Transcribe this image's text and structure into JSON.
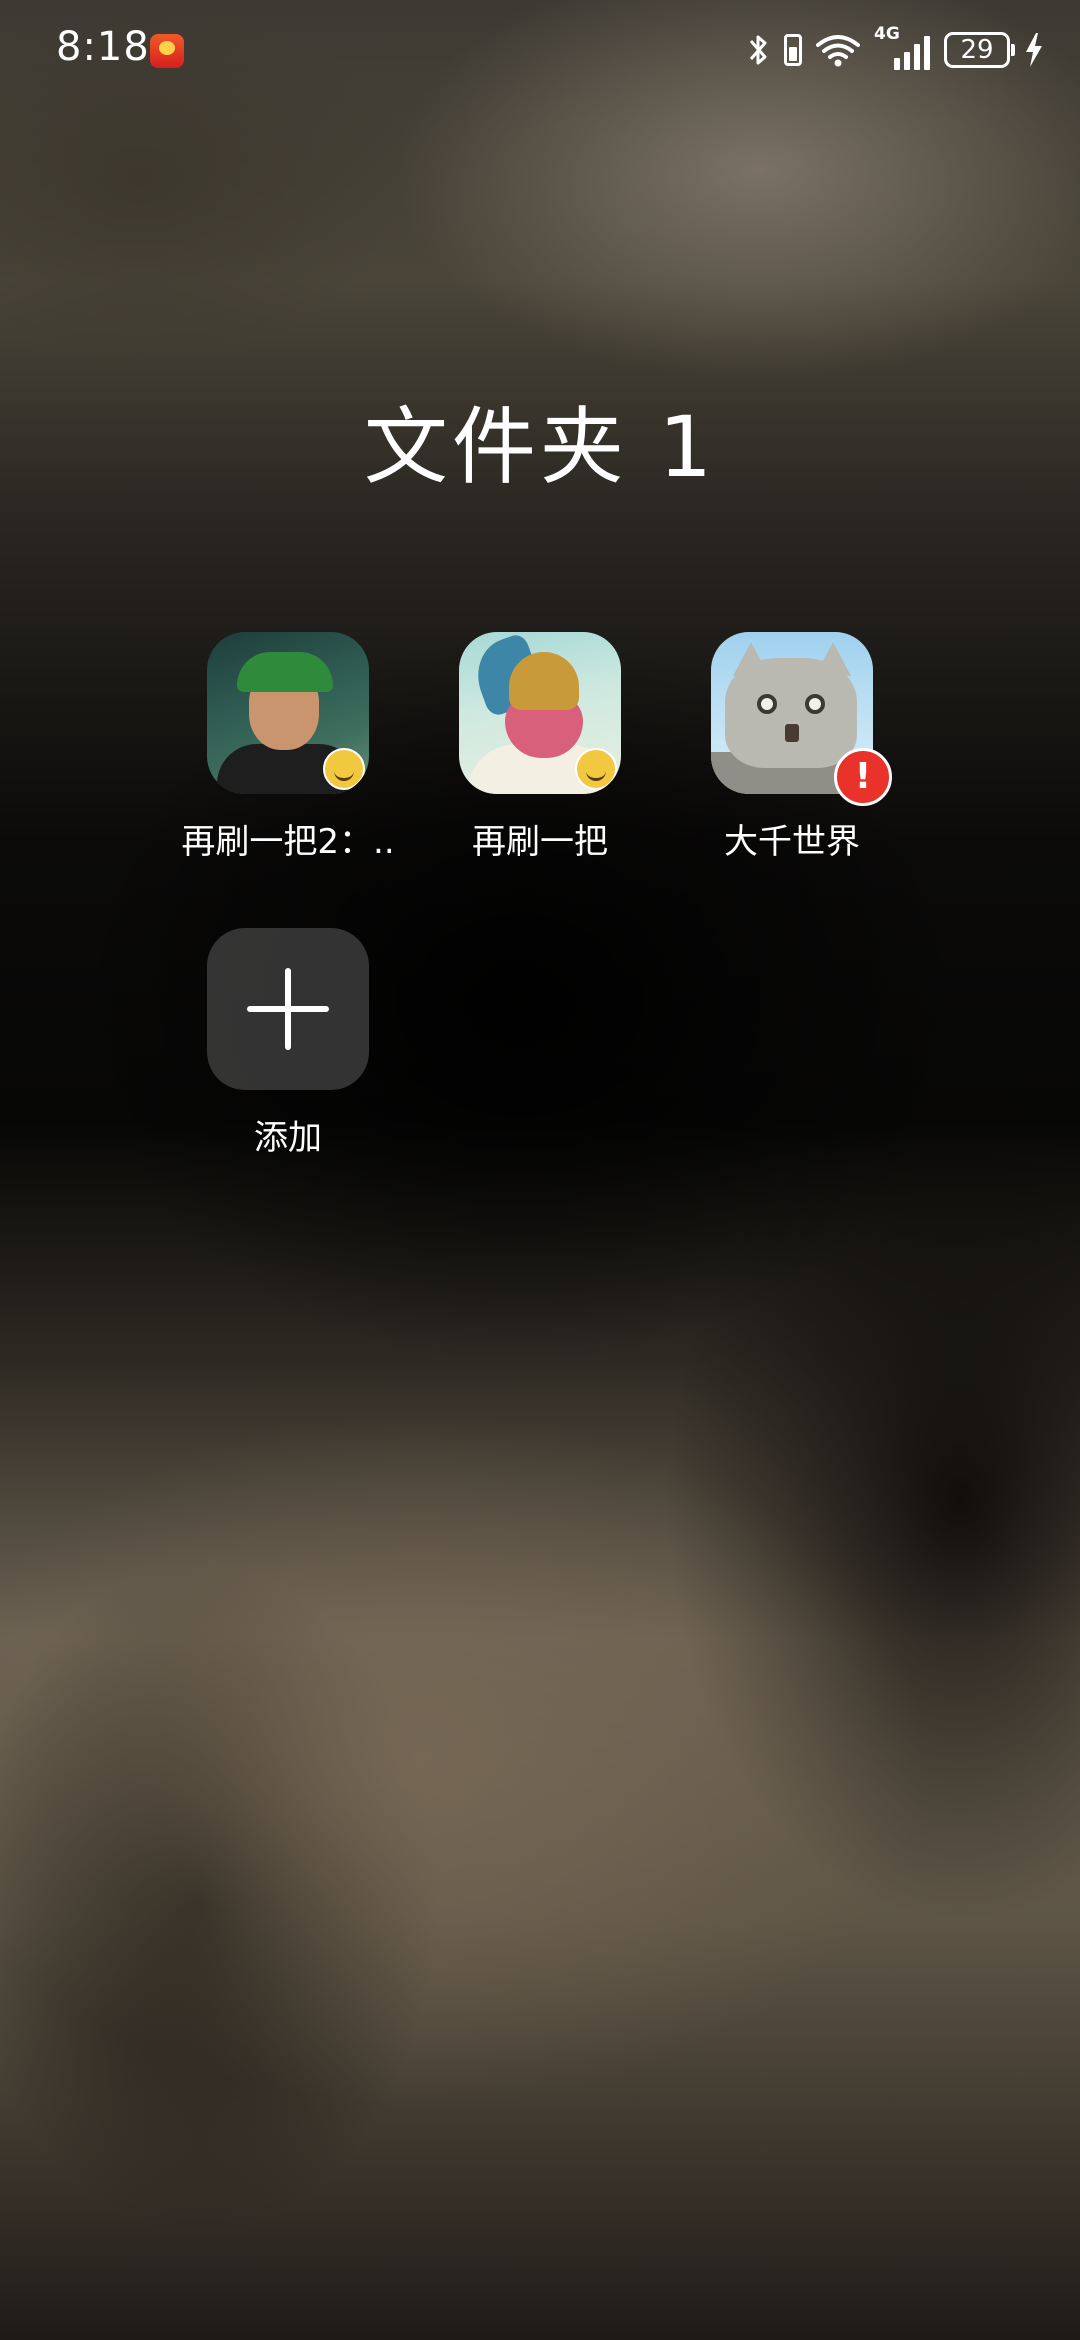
{
  "status_bar": {
    "time": "8:18",
    "network_type": "4G",
    "battery_level": "29",
    "notification_app_icon": "red-app-icon",
    "icons": [
      "bluetooth-icon",
      "vibrate-battery-icon",
      "wifi-icon",
      "signal-icon",
      "battery-icon",
      "charging-icon"
    ]
  },
  "folder": {
    "title": "文件夹 1",
    "apps": [
      {
        "label": "再刷一把2：..",
        "icon": "green-hat-character-icon"
      },
      {
        "label": "再刷一把",
        "icon": "pink-hair-knight-icon"
      },
      {
        "label": "大千世界",
        "icon": "pixel-cat-icon",
        "badge": "!"
      }
    ],
    "add_tile": {
      "label": "添加",
      "icon": "plus-icon"
    }
  }
}
